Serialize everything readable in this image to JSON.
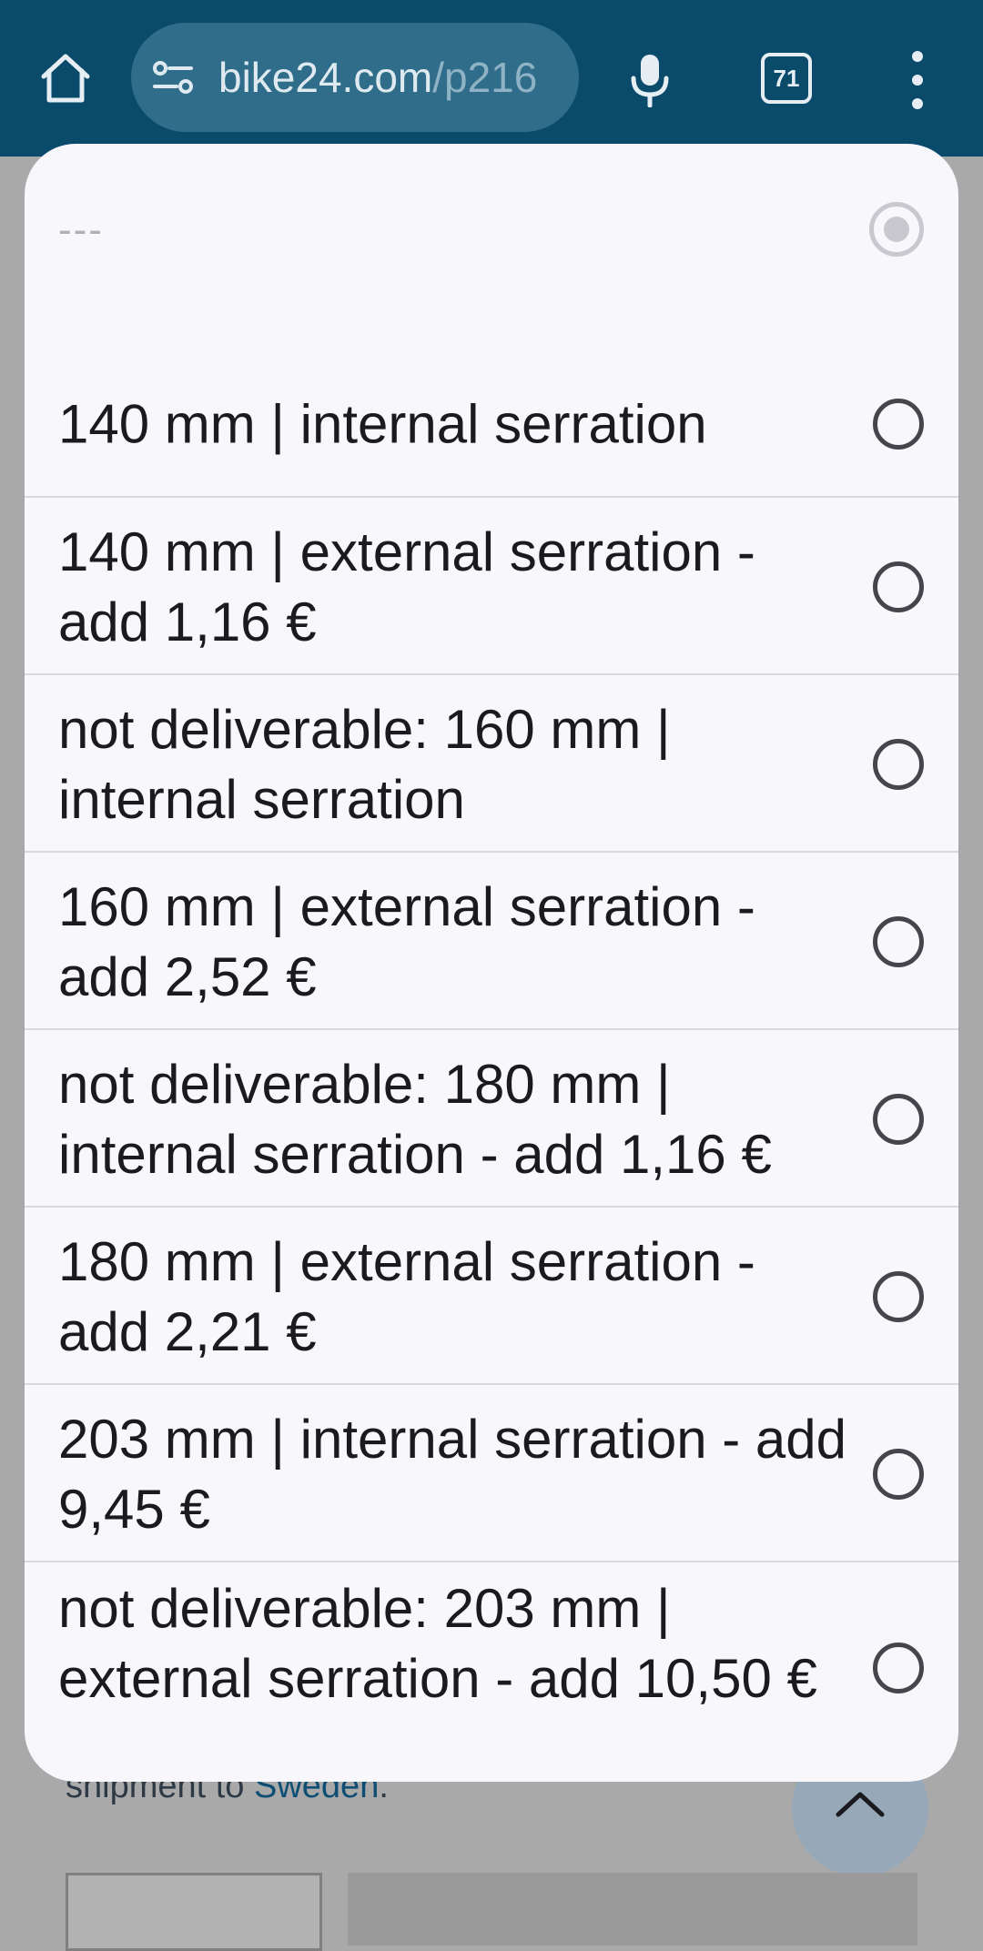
{
  "browser": {
    "url_host": "bike24.com",
    "url_path": "/p216",
    "tab_count": "71"
  },
  "dropdown": {
    "placeholder": "---",
    "options": [
      {
        "label": "140 mm | internal serration"
      },
      {
        "label": "140 mm | external serration - add 1,16 €"
      },
      {
        "label": "not deliverable: 160 mm | internal serration"
      },
      {
        "label": "160 mm | external serration - add 2,52 €"
      },
      {
        "label": "not deliverable: 180 mm | internal serration - add 1,16 €"
      },
      {
        "label": "180 mm | external serration - add 2,21 €"
      },
      {
        "label": "203 mm | internal serration - add 9,45 €"
      },
      {
        "label": "not deliverable: 203 mm | external serration - add 10,50 €"
      }
    ]
  },
  "background": {
    "shipment_prefix": "shipment to ",
    "shipment_country": "Sweden",
    "shipment_suffix": "."
  },
  "colors": {
    "topbar": "#0a4a6b",
    "urlbar": "#2f6d8a",
    "sheet": "#f7f7fc",
    "overlay": "#a9a9a9"
  }
}
